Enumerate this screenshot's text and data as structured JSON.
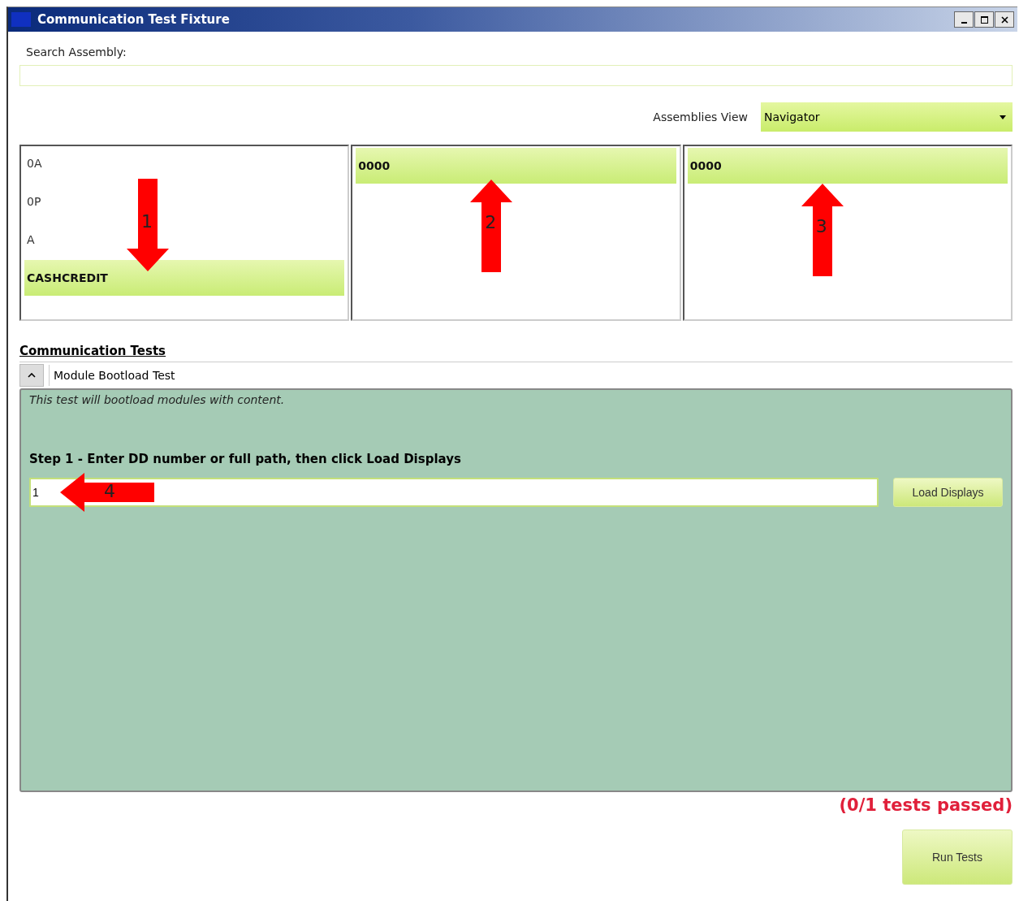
{
  "window": {
    "title": "Communication Test Fixture"
  },
  "search": {
    "label": "Search Assembly:"
  },
  "assemblies_view": {
    "label": "Assemblies View",
    "value": "Navigator"
  },
  "columns": [
    {
      "items": [
        {
          "label": "0A",
          "selected": false
        },
        {
          "label": "0P",
          "selected": false
        },
        {
          "label": "A",
          "selected": false
        },
        {
          "label": "CASHCREDIT",
          "selected": true
        }
      ],
      "annotation": {
        "label": "1",
        "kind": "down"
      }
    },
    {
      "items": [
        {
          "label": "0000",
          "selected": true
        }
      ],
      "annotation": {
        "label": "2",
        "kind": "up"
      }
    },
    {
      "items": [
        {
          "label": "0000",
          "selected": true
        }
      ],
      "annotation": {
        "label": "3",
        "kind": "up"
      }
    }
  ],
  "section_title": "Communication Tests",
  "test": {
    "name": "Module Bootload Test",
    "expanded": true,
    "description": "This test will bootload modules with content.",
    "step": "Step 1 - Enter DD number or full path, then click Load Displays",
    "input_value": "1",
    "annotation": {
      "label": "4",
      "kind": "left"
    },
    "button": "Load Displays"
  },
  "status": "(0/1 tests passed)",
  "run_button": "Run Tests"
}
